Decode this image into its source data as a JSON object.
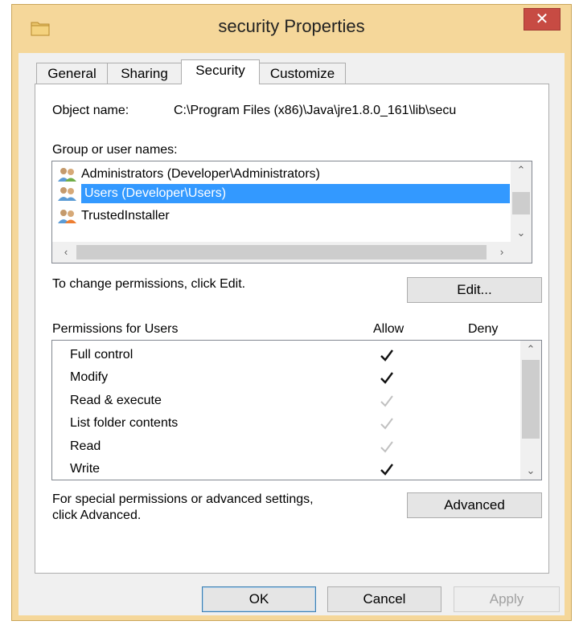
{
  "window": {
    "title": "security Properties",
    "close_glyph": "✕"
  },
  "tabs": [
    {
      "label": "General"
    },
    {
      "label": "Sharing"
    },
    {
      "label": "Security"
    },
    {
      "label": "Customize"
    }
  ],
  "security": {
    "object_name_label": "Object name:",
    "object_name_value": "C:\\Program Files (x86)\\Java\\jre1.8.0_161\\lib\\secu",
    "group_label": "Group or user names:",
    "users": [
      {
        "name": "Administrators (Developer\\Administrators)",
        "selected": false
      },
      {
        "name": "Users (Developer\\Users)",
        "selected": true
      },
      {
        "name": "TrustedInstaller",
        "selected": false
      }
    ],
    "change_text": "To change permissions, click Edit.",
    "edit_button": "Edit...",
    "permissions_label": "Permissions for Users",
    "allow_header": "Allow",
    "deny_header": "Deny",
    "permissions": [
      {
        "name": "Full control",
        "allow": "explicit",
        "deny": false
      },
      {
        "name": "Modify",
        "allow": "explicit",
        "deny": false
      },
      {
        "name": "Read & execute",
        "allow": "inherited",
        "deny": false
      },
      {
        "name": "List folder contents",
        "allow": "inherited",
        "deny": false
      },
      {
        "name": "Read",
        "allow": "inherited",
        "deny": false
      },
      {
        "name": "Write",
        "allow": "explicit",
        "deny": false
      }
    ],
    "advanced_text_line1": "For special permissions or advanced settings,",
    "advanced_text_line2": "click Advanced.",
    "advanced_button": "Advanced"
  },
  "footer": {
    "ok": "OK",
    "cancel": "Cancel",
    "apply": "Apply"
  },
  "colors": {
    "frame": "#f5d79a",
    "close": "#c74b43",
    "selection": "#3399ff"
  }
}
